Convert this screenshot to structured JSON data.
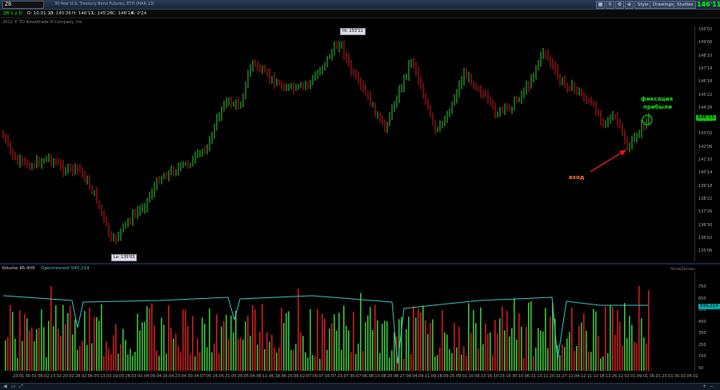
{
  "window": {
    "symbol": "ZB",
    "title": "30-Year U.S. Treasury Bond Futures, ETH (MAR 13)",
    "last_price_badge": "146'11"
  },
  "toolbar": {
    "style_label": "Style",
    "drawings_label": "Drawings",
    "studies_label": "Studies"
  },
  "quote": {
    "symbol_period": "ZB 1 y D",
    "date": "D: 10.01.13",
    "open": "O: 145'26",
    "high": "H: 146'17",
    "low": "L: 145'26",
    "close": "C: 146'14",
    "range": "R: 0'24"
  },
  "copyright": "2012 © TD Ameritrade IP Company, Inc.",
  "price_axis": {
    "labels": [
      "150'02",
      "149'06",
      "148'10",
      "147'14",
      "146'18",
      "145'22",
      "144'26",
      "143'30",
      "143'02",
      "142'06",
      "141'10",
      "140'14",
      "139'18",
      "138'22",
      "137'26",
      "136'30",
      "136'02",
      "135'06"
    ],
    "last": "146'11"
  },
  "callouts": {
    "high": "Hi: 153'11",
    "low": "Lo: 135'03"
  },
  "annotations": {
    "entry": "вход",
    "take_profit_line1": "фиксация",
    "take_profit_line2": "прибыли",
    "arrow_color": "#e8141e",
    "entry_color": "#ff7a1a",
    "profit_color": "#19e619"
  },
  "volume_pane": {
    "volume_label": "Volume",
    "volume_value": "86,409",
    "oi_label": "OpenInterest",
    "oi_value": "545,214",
    "corner": "ShowZeroes",
    "labels": [
      "750",
      "650",
      "550",
      "450",
      "350",
      "250",
      "150",
      "50"
    ],
    "oi_badge": "545,214"
  },
  "time_axis": {
    "labels": [
      "23.01",
      "30.01",
      "06.02",
      "13.02",
      "20.02",
      "28.02",
      "06.03",
      "13.03",
      "19.03",
      "26.03",
      "03.04",
      "09.04",
      "16.04",
      "23.04",
      "30.04",
      "07.05",
      "14.05",
      "21.05",
      "29.05",
      "04.06",
      "11.06",
      "18.06",
      "25.06",
      "02.07",
      "09.07",
      "16.07",
      "23.07",
      "30.07",
      "06.08",
      "13.08",
      "20.08",
      "27.08",
      "04.09",
      "11.09",
      "18.09",
      "25.09",
      "02.10",
      "09.10",
      "16.10",
      "23.10",
      "30.10",
      "06.11",
      "13.11",
      "20.11",
      "27.11",
      "04.12",
      "11.12",
      "18.12",
      "26.12",
      "02.01",
      "09.01",
      "16.01",
      "23.01",
      "30.01",
      "04.02"
    ]
  },
  "colors": {
    "up": "#3cc83c",
    "down": "#d21e1e",
    "oi_line": "#3cc8c8",
    "background": "#000000"
  }
}
